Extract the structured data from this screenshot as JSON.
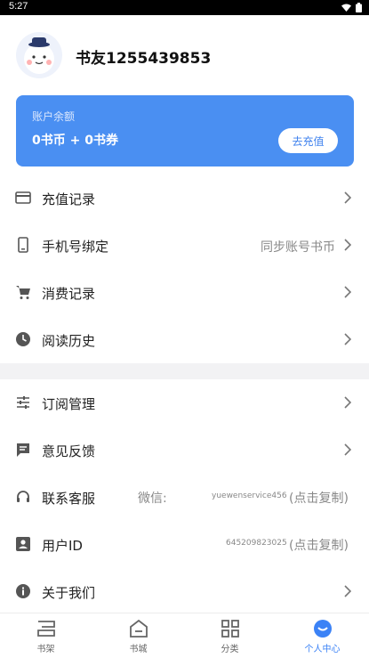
{
  "status_bar": {
    "time": "5:27"
  },
  "profile": {
    "nickname": "书友1255439853"
  },
  "balance": {
    "label": "账户余额",
    "value": "0书币 + 0书券",
    "recharge_label": "去充值"
  },
  "menu": {
    "recharge_history": "充值记录",
    "phone_binding": "手机号绑定",
    "phone_binding_hint": "同步账号书币",
    "purchase_history": "消费记录",
    "reading_history": "阅读历史",
    "subscription": "订阅管理",
    "feedback": "意见反馈",
    "customer_service": "联系客服",
    "wechat_label": "微信:",
    "wechat_id": "yuewenservice456",
    "copy_hint": "(点击复制)",
    "user_id_label": "用户ID",
    "user_id": "645209823025",
    "about": "关于我们"
  },
  "bottom_nav": [
    {
      "label": "书架",
      "icon": "bookshelf-icon"
    },
    {
      "label": "书城",
      "icon": "bookstore-icon"
    },
    {
      "label": "分类",
      "icon": "category-icon"
    },
    {
      "label": "个人中心",
      "icon": "profile-icon"
    }
  ],
  "colors": {
    "accent": "#4a8ff2",
    "active_tab": "#3b82f6"
  }
}
